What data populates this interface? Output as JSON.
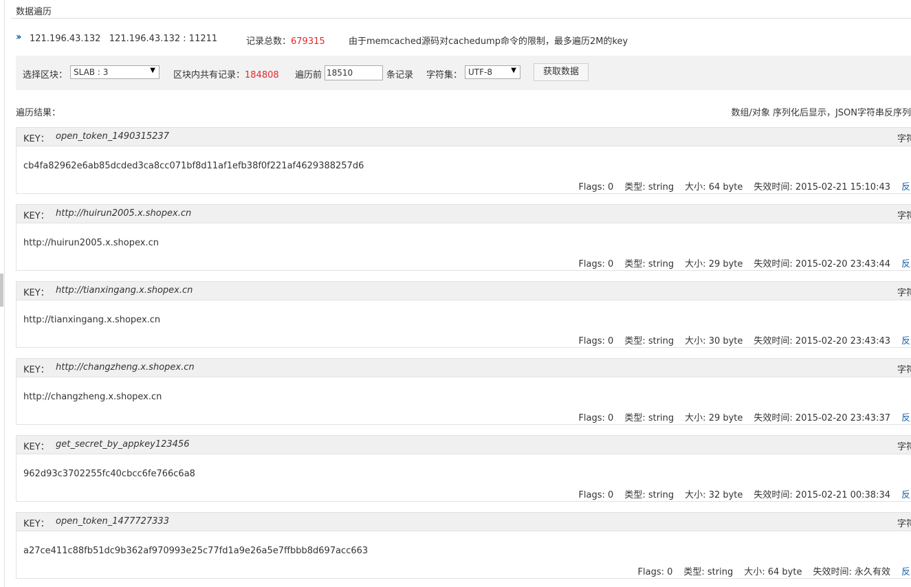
{
  "page": {
    "title": "数据遍历"
  },
  "info": {
    "server": "121.196.43.132   121.196.43.132 : 11211",
    "total_label": "记录总数：",
    "total_value": "679315",
    "note": "由于memcached源码对cachedump命令的限制，最多遍历2M的key"
  },
  "toolbar": {
    "slab_label": "选择区块：",
    "slab_value": "SLAB : 3",
    "block_label": "区块内共有记录：",
    "block_value": "184808",
    "traverse_label": "遍历前",
    "traverse_value": "18510",
    "records_label": "条记录",
    "charset_label": "字符集：",
    "charset_value": "UTF-8",
    "fetch_button": "获取数据"
  },
  "results": {
    "label": "遍历结果：",
    "hint": "数组/对象 序列化后显示，JSON字符串反序列",
    "key_label": "KEY：",
    "charset_link": "字符",
    "flags_label": "Flags: ",
    "type_label": "类型: ",
    "size_label": "大小: ",
    "expire_label": "失效时间: ",
    "reverse_link": "反",
    "items": [
      {
        "key": "open_token_1490315237",
        "value": "cb4fa82962e6ab85dcded3ca8cc071bf8d11af1efb38f0f221af4629388257d6",
        "flags": "0",
        "type": "string",
        "size": "64 byte",
        "expire": "2015-02-21 15:10:43"
      },
      {
        "key": "http://huirun2005.x.shopex.cn",
        "value": "http://huirun2005.x.shopex.cn",
        "flags": "0",
        "type": "string",
        "size": "29 byte",
        "expire": "2015-02-20 23:43:44"
      },
      {
        "key": "http://tianxingang.x.shopex.cn",
        "value": "http://tianxingang.x.shopex.cn",
        "flags": "0",
        "type": "string",
        "size": "30 byte",
        "expire": "2015-02-20 23:43:43"
      },
      {
        "key": "http://changzheng.x.shopex.cn",
        "value": "http://changzheng.x.shopex.cn",
        "flags": "0",
        "type": "string",
        "size": "29 byte",
        "expire": "2015-02-20 23:43:37"
      },
      {
        "key": "get_secret_by_appkey123456",
        "value": "962d93c3702255fc40cbcc6fe766c6a8",
        "flags": "0",
        "type": "string",
        "size": "32 byte",
        "expire": "2015-02-21 00:38:34"
      },
      {
        "key": "open_token_1477727333",
        "value": "a27ce411c88fb51dc9b362af970993e25c77fd1a9e26a5e7ffbbb8d697acc663",
        "flags": "0",
        "type": "string",
        "size": "64 byte",
        "expire": "永久有效"
      }
    ]
  }
}
